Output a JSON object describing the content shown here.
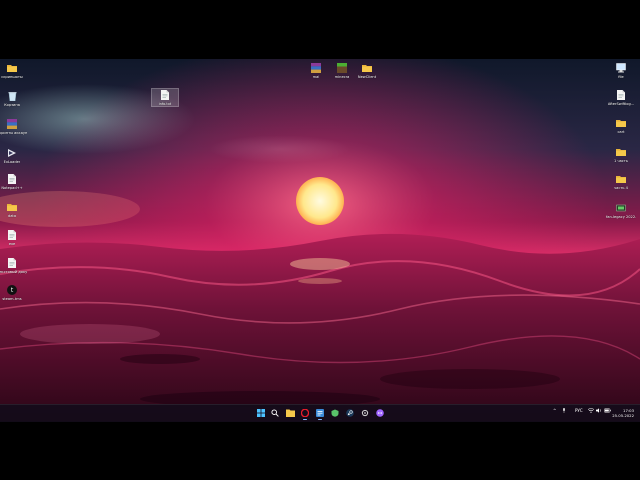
{
  "colors": {
    "taskbar": "#140c1a",
    "folder": "#e8b339",
    "accent": "#7fb8ff"
  },
  "desktop_left": [
    {
      "label": "скриншоты",
      "icon": "folder-icon"
    },
    {
      "label": "Корзина",
      "icon": "recycle-bin-icon"
    },
    {
      "label": "скрипты аккаунтов",
      "icon": "winrar-icon"
    },
    {
      "label": "ExLoader",
      "icon": "exloader-icon"
    },
    {
      "label": "Notepad++",
      "icon": "document-icon"
    },
    {
      "label": "data",
      "icon": "folder-icon"
    },
    {
      "label": "exe",
      "icon": "document-icon"
    },
    {
      "label": "Текстовый документ",
      "icon": "document-icon"
    },
    {
      "label": "steam-tms",
      "icon": "app-icon"
    }
  ],
  "desktop_top": [
    {
      "label": "mai",
      "icon": "winrar-icon"
    },
    {
      "label": "minecra",
      "icon": "minecraft-icon"
    },
    {
      "label": "NewClient",
      "icon": "folder-icon"
    }
  ],
  "desktop_selected": {
    "label": "info.txt",
    "icon": "document-icon"
  },
  "desktop_right": [
    {
      "label": "file",
      "icon": "pc-icon"
    },
    {
      "label": "AfterSwiftlog...",
      "icon": "document-icon"
    },
    {
      "label": "cart",
      "icon": "folder-icon"
    },
    {
      "label": "1 часть",
      "icon": "folder-icon"
    },
    {
      "label": "часть 4",
      "icon": "folder-icon"
    },
    {
      "label": "fan-legacy 2022.07.1...",
      "icon": "installer-icon"
    }
  ],
  "taskbar": {
    "apps": [
      {
        "name": "start-button"
      },
      {
        "name": "search-icon"
      },
      {
        "name": "file-explorer-icon"
      },
      {
        "name": "opera-icon"
      },
      {
        "name": "editor-icon"
      },
      {
        "name": "vpn-icon"
      },
      {
        "name": "steam-icon"
      },
      {
        "name": "settings-icon"
      },
      {
        "name": "discord-icon"
      }
    ],
    "tray": {
      "chevron": "^",
      "mic": "🎙",
      "lang": "РУС",
      "wifi": "wifi",
      "volume": "vol",
      "battery": "bat"
    },
    "time": "17:03",
    "date": "25.05.2022"
  }
}
